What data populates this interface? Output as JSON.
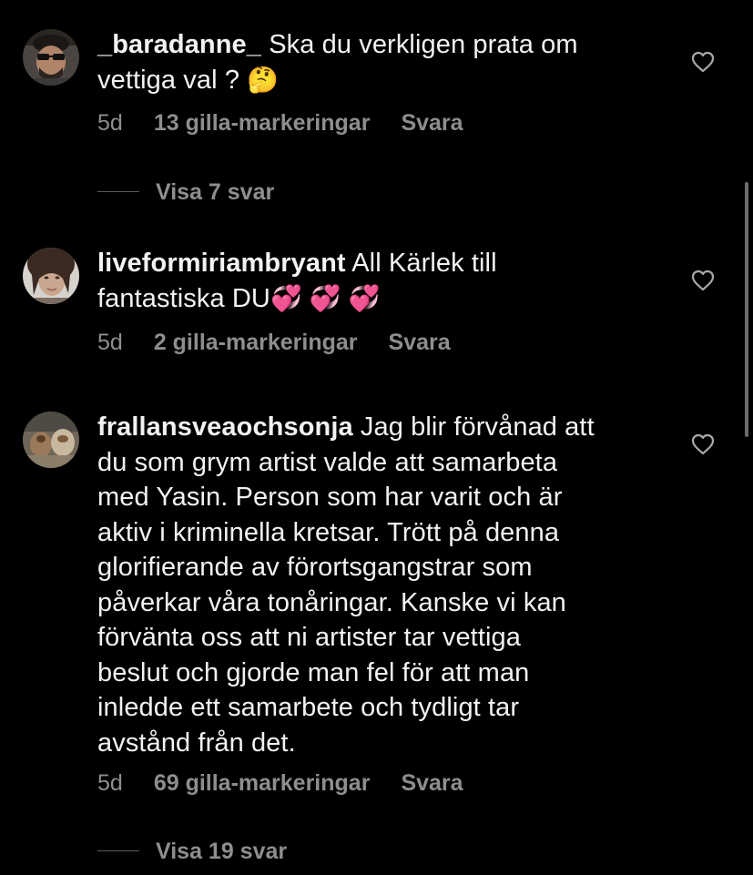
{
  "comments": [
    {
      "username": "_baradanne_",
      "text_lines": [
        "Ska du verkligen prata om",
        "vettiga val ?"
      ],
      "emoji": "🤔",
      "time": "5d",
      "likes": "13 gilla-markeringar",
      "reply": "Svara",
      "view_replies": "Visa 7 svar"
    },
    {
      "username": "liveformiriambryant",
      "text_lines": [
        "All Kärlek till",
        "fantastiska DU"
      ],
      "emoji": "💞 💞 💞",
      "time": "5d",
      "likes": "2 gilla-markeringar",
      "reply": "Svara"
    },
    {
      "username": "frallansveaochsonja",
      "text_lines": [
        "Jag blir förvånad att",
        "du som grym artist valde att samarbeta",
        "med Yasin. Person som har varit och är",
        "aktiv i kriminella kretsar. Trött på denna",
        "glorifierande av förortsgangstrar som",
        "påverkar våra tonåringar. Kanske vi kan",
        "förvänta oss att ni artister tar vettiga",
        "beslut och gjorde man fel för att man",
        "inledde ett samarbete och tydligt tar",
        "avstånd från det."
      ],
      "time": "5d",
      "likes": "69 gilla-markeringar",
      "reply": "Svara",
      "view_replies": "Visa 19 svar"
    }
  ],
  "icons": {
    "like": "heart-outline-icon"
  },
  "colors": {
    "background": "#000000",
    "text": "#f2f2f2",
    "secondary": "#8e8e8e"
  }
}
